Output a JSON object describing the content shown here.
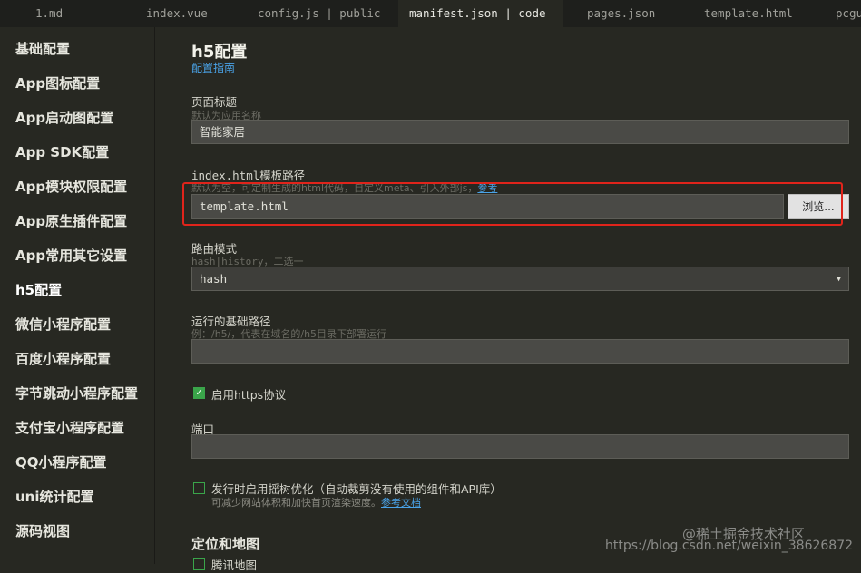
{
  "tabs": [
    {
      "label": "1.md"
    },
    {
      "label": "index.vue"
    },
    {
      "label": "config.js | public"
    },
    {
      "label": "manifest.json | code",
      "active": true
    },
    {
      "label": "pages.json"
    },
    {
      "label": "template.html"
    },
    {
      "label": "pcgu"
    }
  ],
  "sidebar": {
    "items": [
      "基础配置",
      "App图标配置",
      "App启动图配置",
      "App SDK配置",
      "App模块权限配置",
      "App原生插件配置",
      "App常用其它设置",
      "h5配置",
      "微信小程序配置",
      "百度小程序配置",
      "字节跳动小程序配置",
      "支付宝小程序配置",
      "QQ小程序配置",
      "uni统计配置",
      "源码视图"
    ],
    "active_index": 7
  },
  "main": {
    "title": "h5配置",
    "guide_link": "配置指南",
    "page_title": {
      "label": "页面标题",
      "hint": "默认为应用名称",
      "value": "智能家居"
    },
    "template": {
      "label": "index.html模板路径",
      "hint": "默认为空，可定制生成的html代码，自定义meta、引入外部js，",
      "hint_link": "参考",
      "value": "template.html",
      "browse_label": "浏览..."
    },
    "router": {
      "label": "路由模式",
      "hint": "hash|history，二选一",
      "value": "hash"
    },
    "base_path": {
      "label": "运行的基础路径",
      "hint": "例：/h5/，代表在域名的/h5目录下部署运行",
      "value": ""
    },
    "https": {
      "label": "启用https协议",
      "checked": true
    },
    "port": {
      "label": "端口",
      "value": ""
    },
    "treeshake": {
      "label": "发行时启用摇树优化（自动裁剪没有使用的组件和API库）",
      "hint": "可减少网站体积和加快首页渲染速度。",
      "hint_link": "参考文档",
      "checked": false
    },
    "map_section": "定位和地图",
    "map_item": "腾讯地图"
  },
  "watermarks": {
    "csdn": "https://blog.csdn.net/weixin_38626872",
    "juejin": "@稀土掘金技术社区"
  },
  "colors": {
    "accent_link": "#4aa3e8",
    "checkbox": "#3aa54a",
    "highlight_box": "#e0241b"
  }
}
